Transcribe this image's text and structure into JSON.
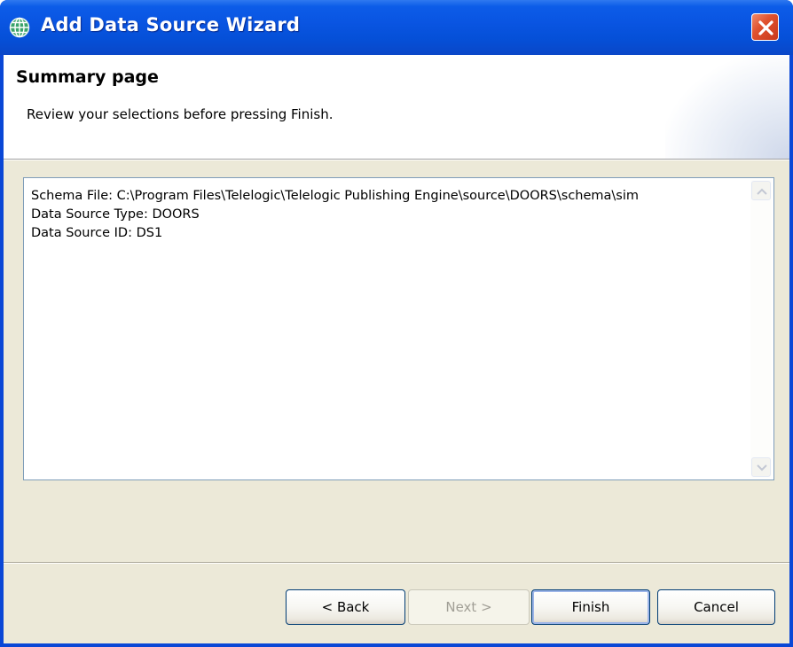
{
  "window": {
    "title": "Add Data Source Wizard",
    "title_icon": "globe-icon",
    "close_icon": "close-icon"
  },
  "banner": {
    "title": "Summary page",
    "description": "Review your selections before pressing Finish."
  },
  "summary": {
    "lines": [
      "Schema File: C:\\Program Files\\Telelogic\\Telelogic Publishing Engine\\source\\DOORS\\schema\\sim",
      "Data Source Type: DOORS",
      "Data Source ID: DS1"
    ]
  },
  "buttons": {
    "back": "< Back",
    "next": "Next >",
    "finish": "Finish",
    "cancel": "Cancel"
  },
  "colors": {
    "titlebar": "#0a55e2",
    "client_bg": "#ece9d8",
    "close_button": "#e0522e"
  }
}
